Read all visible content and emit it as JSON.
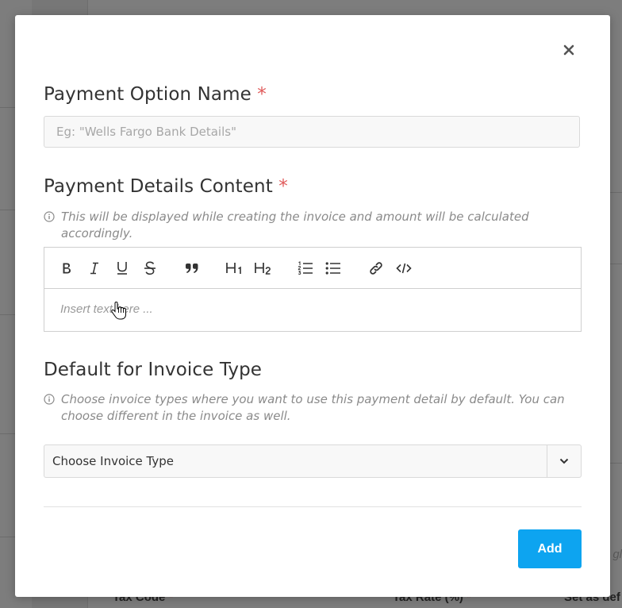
{
  "background": {
    "footer_tax_code": "Tax Code",
    "footer_tax_rate": "Tax Rate (%)",
    "footer_set_default": "Set as def",
    "required_mark": "*",
    "ghost_text": "gl"
  },
  "modal": {
    "close_label": "×",
    "payment_option": {
      "title": "Payment Option Name",
      "required_mark": "*",
      "placeholder": "Eg: \"Wells Fargo Bank Details\"",
      "value": ""
    },
    "payment_details": {
      "title": "Payment Details Content",
      "required_mark": "*",
      "hint": "This will be displayed while creating the invoice and amount will be calculated accordingly.",
      "editor_placeholder": "Insert text here ...",
      "toolbar": [
        {
          "name": "bold-button",
          "icon": "bold-icon"
        },
        {
          "name": "italic-button",
          "icon": "italic-icon"
        },
        {
          "name": "underline-button",
          "icon": "underline-icon"
        },
        {
          "name": "strikethrough-button",
          "icon": "strikethrough-icon"
        },
        {
          "name": "blockquote-button",
          "icon": "quote-icon"
        },
        {
          "name": "heading1-button",
          "icon": "h1-icon"
        },
        {
          "name": "heading2-button",
          "icon": "h2-icon"
        },
        {
          "name": "ordered-list-button",
          "icon": "ordered-list-icon"
        },
        {
          "name": "bullet-list-button",
          "icon": "bullet-list-icon"
        },
        {
          "name": "link-button",
          "icon": "link-icon"
        },
        {
          "name": "code-button",
          "icon": "code-icon"
        }
      ]
    },
    "default_invoice": {
      "title": "Default for Invoice Type",
      "hint": "Choose invoice types where you want to use this payment detail by default. You can choose different in the invoice as well.",
      "select_value": "Choose Invoice Type"
    },
    "add_label": "Add"
  },
  "colors": {
    "accent": "#0da4f0",
    "required": "#e05a5a",
    "overlay": "#7d7d7d"
  }
}
